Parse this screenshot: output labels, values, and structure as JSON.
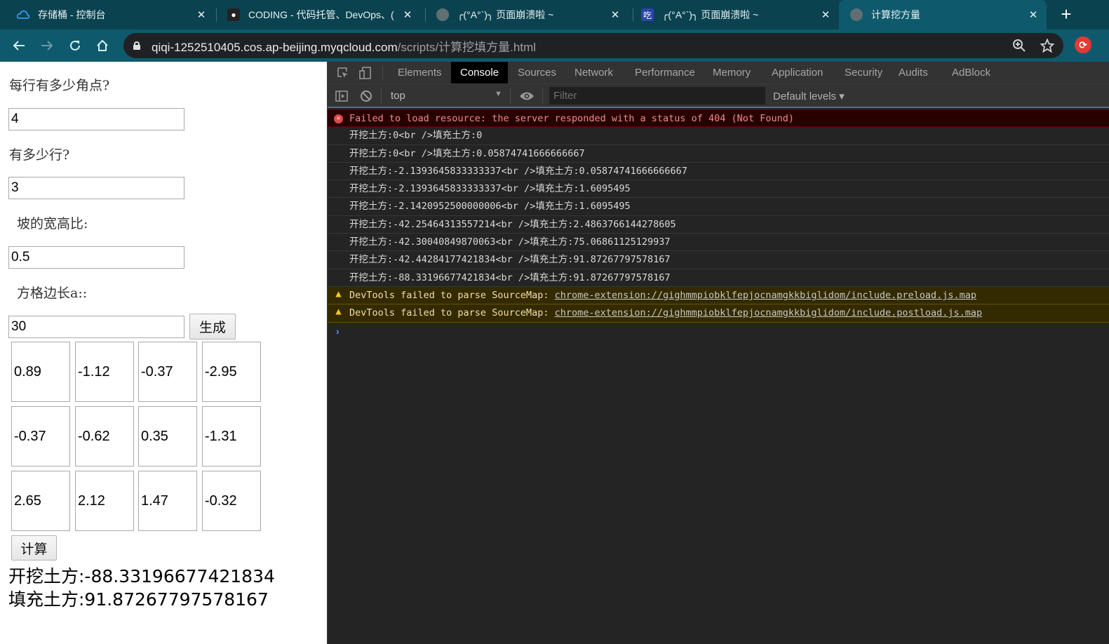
{
  "browser": {
    "tabs": [
      {
        "title": "存储桶 - 控制台",
        "icon": "cloud-icon",
        "active": false
      },
      {
        "title": "CODING - 代码托管、DevOps、(",
        "icon": "coding-icon",
        "active": false
      },
      {
        "title": "╭(°A°`)╮ 页面崩溃啦 ~",
        "icon": "globe-icon",
        "active": false
      },
      {
        "title": "╭(°A°`)╮ 页面崩溃啦 ~",
        "icon": "chi-icon",
        "icon_text": "吃",
        "active": false
      },
      {
        "title": "计算挖方量",
        "icon": "globe-icon",
        "active": true
      }
    ],
    "close_glyph": "✕",
    "new_tab_glyph": "+",
    "url_host": "qiqi-1252510405.cos.ap-beijing.myqcloud.com",
    "url_path": "/scripts/计算挖填方量.html"
  },
  "page": {
    "label_corners_per_row": "每行有多少角点?",
    "value_corners_per_row": "4",
    "label_rows": "有多少行?",
    "value_rows": "3",
    "label_slope_ratio": "坡的宽高比:",
    "value_slope_ratio": "0.5",
    "label_grid_side": "方格边长a::",
    "value_grid_side": "30",
    "generate_button": "生成",
    "grid": [
      [
        "0.89",
        "-1.12",
        "-0.37",
        "-2.95"
      ],
      [
        "-0.37",
        "-0.62",
        "0.35",
        "-1.31"
      ],
      [
        "2.65",
        "2.12",
        "1.47",
        "-0.32"
      ]
    ],
    "calculate_button": "计算",
    "result_cut": "开挖土方:-88.33196677421834",
    "result_fill": "填充土方:91.87267797578167"
  },
  "devtools": {
    "tabs": [
      "Elements",
      "Console",
      "Sources",
      "Network",
      "Performance",
      "Memory",
      "Application",
      "Security",
      "Audits",
      "AdBlock"
    ],
    "active_tab": "Console",
    "context": "top",
    "filter_placeholder": "Filter",
    "levels": "Default levels ▾",
    "messages": [
      {
        "type": "error",
        "text": "Failed to load resource: the server responded with a status of 404 (Not Found)"
      },
      {
        "type": "log",
        "text": "开挖土方:0<br />填充土方:0"
      },
      {
        "type": "log",
        "text": "开挖土方:0<br />填充土方:0.05874741666666667"
      },
      {
        "type": "log",
        "text": "开挖土方:-2.1393645833333337<br />填充土方:0.05874741666666667"
      },
      {
        "type": "log",
        "text": "开挖土方:-2.1393645833333337<br />填充土方:1.6095495"
      },
      {
        "type": "log",
        "text": "开挖土方:-2.1420952500000006<br />填充土方:1.6095495"
      },
      {
        "type": "log",
        "text": "开挖土方:-42.25464313557214<br />填充土方:2.4863766144278605"
      },
      {
        "type": "log",
        "text": "开挖土方:-42.30040849870063<br />填充土方:75.06861125129937"
      },
      {
        "type": "log",
        "text": "开挖土方:-42.44284177421834<br />填充土方:91.87267797578167"
      },
      {
        "type": "log",
        "text": "开挖土方:-88.33196677421834<br />填充土方:91.87267797578167"
      },
      {
        "type": "warn",
        "text": "DevTools failed to parse SourceMap: ",
        "link": "chrome-extension://gighmmpiobklfepjocnamgkkbiglidom/include.preload.js.map"
      },
      {
        "type": "warn",
        "text": "DevTools failed to parse SourceMap: ",
        "link": "chrome-extension://gighmmpiobklfepjocnamgkkbiglidom/include.postload.js.map"
      }
    ],
    "prompt_glyph": "›"
  }
}
